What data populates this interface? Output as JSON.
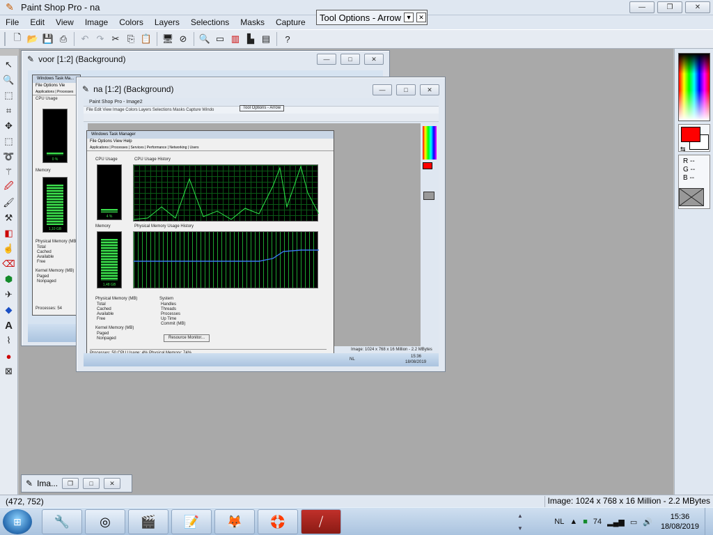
{
  "app": {
    "title": "Paint Shop Pro - na"
  },
  "window_controls": {
    "minimize": "—",
    "restore": "❐",
    "close": "✕"
  },
  "menu": [
    "File",
    "Edit",
    "View",
    "Image",
    "Colors",
    "Layers",
    "Selections",
    "Masks",
    "Capture",
    "Windo"
  ],
  "tool_options": {
    "title": "Tool Options - Arrow",
    "dropdown": "▼",
    "close": "✕"
  },
  "toolbar": {
    "icons": [
      "new-icon",
      "open-icon",
      "save-icon",
      "print-icon",
      "undo-icon",
      "redo-icon",
      "cut-icon",
      "copy-icon",
      "paste-icon",
      "full-screen-preview-icon",
      "normal-viewing-icon",
      "zoom-icon",
      "toggle-toolbar-icon",
      "toggle-color-palette-icon",
      "toggle-histogram-icon",
      "context-help-icon"
    ]
  },
  "tools": [
    "arrow-tool",
    "zoom-tool",
    "deformation-tool",
    "crop-tool",
    "mover-tool",
    "selection-tool",
    "freehand-tool",
    "magic-wand-tool",
    "dropper-tool",
    "paintbrush-tool",
    "clone-brush-tool",
    "color-replacer-tool",
    "retouch-tool",
    "eraser-tool",
    "picture-tube-tool",
    "airbrush-tool",
    "flood-fill-tool",
    "text-tool",
    "draw-tool",
    "preset-shapes-tool",
    "object-selector-tool"
  ],
  "documents": {
    "voor": {
      "title": "voor [1:2] (Background)",
      "tabs": [
        "Applications",
        "Processes"
      ],
      "menu": [
        "File",
        "Options",
        "Vie"
      ],
      "cpu_label": "CPU Usage",
      "cpu_value": "0 %",
      "mem_label": "Memory",
      "mem_value": "1,10 GB",
      "phys_label": "Physical Memory (MB)",
      "phys_rows": [
        "Total",
        "Cached",
        "Available",
        "Free"
      ],
      "kernel_label": "Kernel Memory (MB)",
      "kernel_rows": [
        "Paged",
        "Nonpaged"
      ],
      "status": "Processes: 54"
    },
    "na": {
      "title": "na [1:2] (Background)",
      "inner_title": "Paint Shop Pro - Image2",
      "inner_menu": "File  Edit  View  Image  Colors  Layers  Selections  Masks  Capture  Windo",
      "inner_tool_options": "Tool Options - Arrow",
      "tm_title": "Windows Task Manager",
      "tm_menu": "File   Options   View   Help",
      "tm_tabs": "Applications | Processes | Services | Performance | Networking | Users",
      "cpu_label": "CPU Usage",
      "cpu_history_label": "CPU Usage History",
      "cpu_value": "4 %",
      "mem_label": "Memory",
      "mem_history_label": "Physical Memory Usage History",
      "mem_value": "1,48 GB",
      "phys_label": "Physical Memory (MB)",
      "phys_rows": [
        "Total",
        "Cached",
        "Available",
        "Free"
      ],
      "system_label": "System",
      "system_rows": [
        "Handles",
        "Threads",
        "Processes",
        "Up Time",
        "Commit (MB)"
      ],
      "kernel_label": "Kernel Memory (MB)",
      "kernel_rows": [
        "Paged",
        "Nonpaged"
      ],
      "resource_btn": "Resource Monitor...",
      "tm_status": "Processes: 50     CPU Usage: 4%     Physical Memory: 74%",
      "inner_status": "Image: 1024 x 768 x 16 Million - 2.2 MBytes",
      "inner_clock_time": "15:36",
      "inner_clock_date": "18/08/2019",
      "inner_tray_lang": "NL"
    }
  },
  "minimized": {
    "title": "Ima..."
  },
  "status": {
    "coords": "(472, 752)",
    "image_info": "Image:  1024 x 768 x 16 Million - 2.2 MBytes"
  },
  "colors": {
    "foreground": "#ff0000",
    "background": "#ffffff",
    "r_label": "R --",
    "g_label": "G --",
    "b_label": "B --"
  },
  "taskbar": {
    "apps": [
      "control-panel-icon",
      "media-center-icon",
      "video-editor-icon",
      "notepad-icon",
      "firefox-icon",
      "help-lifebuoy-icon",
      "pdf-reader-icon"
    ],
    "language": "NL",
    "tray_number": "74",
    "time": "15:36",
    "date": "18/08/2019"
  }
}
